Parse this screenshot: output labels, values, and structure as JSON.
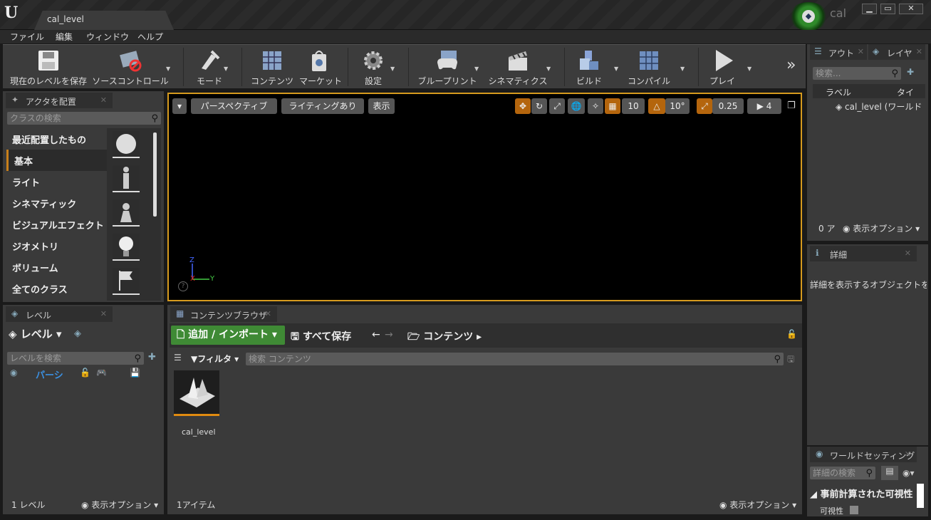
{
  "window": {
    "doc_tab": "cal_level",
    "user_name": "cal",
    "min_label": "▁",
    "max_label": "▭",
    "close_label": "✕"
  },
  "menu": [
    "ファイル",
    "編集",
    "ウィンドウ",
    "ヘルプ"
  ],
  "toolbar": {
    "items": [
      "現在のレベルを保存",
      "ソースコントロール",
      "モード",
      "コンテンツ",
      "マーケット",
      "設定",
      "ブループリント",
      "シネマティクス",
      "ビルド",
      "コンパイル",
      "プレイ"
    ],
    "more": "»"
  },
  "place_actors": {
    "tab": "アクタを配置",
    "search_placeholder": "クラスの検索",
    "categories": [
      "最近配置したもの",
      "基本",
      "ライト",
      "シネマティック",
      "ビジュアルエフェクト",
      "ジオメトリ",
      "ボリューム",
      "全てのクラス"
    ],
    "selected_index": 1
  },
  "viewport": {
    "perspective": "パースペクティブ",
    "lighting": "ライティングあり",
    "show": "表示",
    "grid_snap": "10",
    "rot_snap": "10°",
    "scale_snap": "0.25",
    "cam_speed": "4",
    "axis_z": "Z",
    "axis_y": "Y",
    "axis_x": "X"
  },
  "levels": {
    "tab": "レベル",
    "dropdown": "レベル",
    "search_placeholder": "レベルを検索",
    "persistent": "パーシ",
    "count": "1 レベル",
    "view_options": "表示オプション"
  },
  "content_browser": {
    "tab": "コンテンツブラウザ",
    "add_import": "追加 / インポート",
    "save_all": "すべて保存",
    "path": "コンテンツ",
    "filter": "フィルタ",
    "search_placeholder": "検索 コンテンツ",
    "asset_name": "cal_level",
    "item_count": "1アイテム",
    "view_options": "表示オプション"
  },
  "outliner": {
    "tab1": "アウト",
    "tab2": "レイヤ",
    "search_placeholder": "検索...",
    "col_label": "ラベル",
    "col_type": "タイ",
    "row": "cal_level (ワールド",
    "count": "0 ア",
    "view_options": "表示オプション"
  },
  "details": {
    "tab": "詳細",
    "empty_msg": "詳細を表示するオブジェクトを選"
  },
  "world_settings": {
    "tab": "ワールドセッティング",
    "search_placeholder": "詳細の検索",
    "section": "事前計算された可視性",
    "prop": "可視性"
  }
}
